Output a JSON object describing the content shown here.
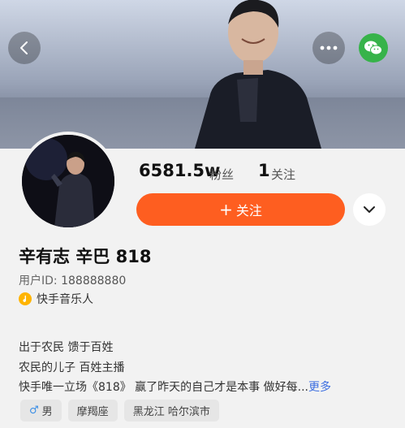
{
  "profile": {
    "fans_count": "6581.5w",
    "fans_label": "粉丝",
    "following_count": "1",
    "following_label": "关注",
    "follow_button_icon": "+",
    "follow_button_label": "关注",
    "name": "辛有志 辛巴 818",
    "user_id_label": "用户ID:",
    "user_id": "188888880",
    "verification": "快手音乐人",
    "bio": [
      "出于农民 馈于百姓",
      "农民的儿子 百姓主播",
      "快手唯一立场《818》 赢了昨天的自己才是本事   做好每"
    ],
    "bio_ellipsis": "...",
    "more_label": "更多",
    "tags": {
      "gender_symbol": "♂",
      "gender": "男",
      "zodiac": "摩羯座",
      "location": "黑龙江 哈尔滨市"
    }
  },
  "colors": {
    "follow_button": "#fe5e20",
    "wechat": "#37b34a",
    "link": "#3d6fe0"
  },
  "icons": [
    "back-icon",
    "more-dots-icon",
    "wechat-icon",
    "chevron-down-icon",
    "music-verified-icon",
    "male-icon"
  ]
}
